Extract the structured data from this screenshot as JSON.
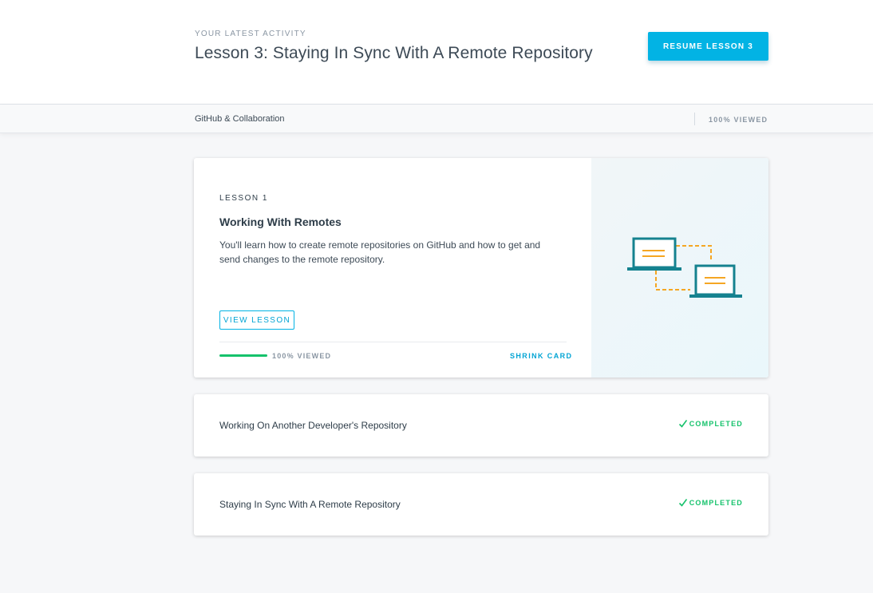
{
  "header": {
    "eyebrow": "YOUR LATEST ACTIVITY",
    "title": "Lesson 3: Staying In Sync With A Remote Repository",
    "resume_label": "RESUME LESSON 3"
  },
  "subbar": {
    "course_name": "GitHub & Collaboration",
    "viewed_label": "100% VIEWED"
  },
  "lesson_card": {
    "label": "LESSON 1",
    "title": "Working With Remotes",
    "description": "You'll learn how to create remote repositories on GitHub and how to get and send changes to the remote repository.",
    "view_label": "VIEW LESSON",
    "progress_percent": 100,
    "progress_label": "100% VIEWED",
    "shrink_label": "SHRINK CARD",
    "illustration": "two-laptops-sync-icon"
  },
  "lessons": [
    {
      "title": "Working On Another Developer's Repository",
      "status": "COMPLETED"
    },
    {
      "title": "Staying In Sync With A Remote Repository",
      "status": "COMPLETED"
    }
  ],
  "colors": {
    "accent": "#02b3e4",
    "success": "#15c26b",
    "laptop": "#15828f",
    "laptop_lines": "#f5a623"
  }
}
